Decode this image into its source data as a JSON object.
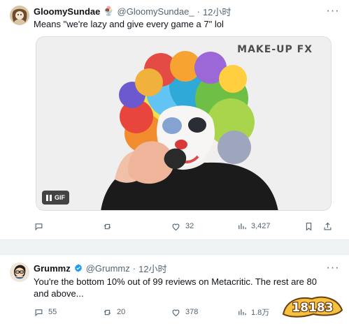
{
  "tweets": [
    {
      "display_name": "GloomySundae",
      "badge": "🍨",
      "handle": "@GloomySundae_",
      "dot": "·",
      "time": "12小时",
      "more_icon": "···",
      "text": "Means \"we're lazy and give every game a 7\" lol",
      "media": {
        "watermark": "MAKE-UP FX",
        "gif_label": "GIF",
        "corner_text": "Gif"
      },
      "actions": {
        "reply": "",
        "retweet": "",
        "like": "32",
        "views": "3,427"
      }
    },
    {
      "display_name": "Grummz",
      "handle": "@Grummz",
      "dot": "·",
      "time": "12小时",
      "more_icon": "···",
      "text": "You're the bottom 10% out of 99 reviews on Metacritic. The rest are 80 and above...",
      "actions": {
        "reply": "55",
        "retweet": "20",
        "like": "378",
        "views": "1.8万"
      }
    }
  ],
  "brand": {
    "text": "18183"
  },
  "colors": {
    "text": "#0f1419",
    "muted": "#536471",
    "verified": "#1d9bf0",
    "separator": "#eff3f4",
    "brand_yellow": "#f6c23e",
    "brand_outline": "#6b3b12"
  }
}
